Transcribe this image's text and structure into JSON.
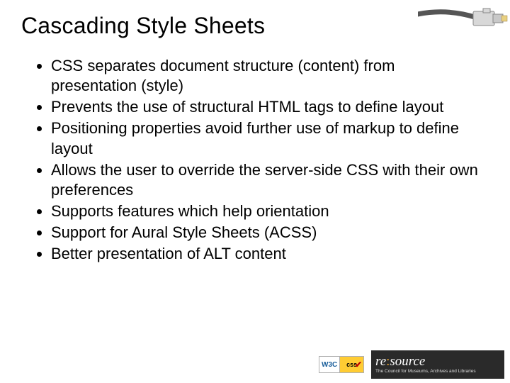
{
  "title": "Cascading Style Sheets",
  "bullets": [
    "CSS separates document structure (content) from presentation (style)",
    "Prevents the use of structural HTML tags to define layout",
    "Positioning properties avoid further use of markup to define layout",
    "Allows the user to override the server-side CSS with their own preferences",
    "Supports features which help orientation",
    "Support for Aural Style Sheets (ACSS)",
    "Better presentation of ALT content"
  ],
  "footer": {
    "w3c_left": "W3C",
    "w3c_right": "css",
    "resource_brand_prefix": "re",
    "resource_brand_suffix": "source",
    "resource_tagline": "The Council for Museums, Archives and Libraries"
  }
}
